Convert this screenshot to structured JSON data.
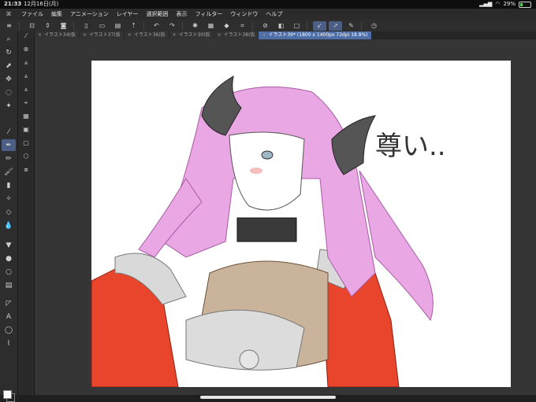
{
  "status": {
    "time": "21:33",
    "date": "12月16日(月)",
    "battery": "29%"
  },
  "menu": {
    "items": [
      "ファイル",
      "編集",
      "アニメーション",
      "レイヤー",
      "選択範囲",
      "表示",
      "フィルター",
      "ウィンドウ",
      "ヘルプ"
    ]
  },
  "tabs": [
    {
      "label": "イラスト34(仮"
    },
    {
      "label": "イラスト37(仮"
    },
    {
      "label": "イラスト36(仮"
    },
    {
      "label": "イラスト30(仮"
    },
    {
      "label": "イラスト38(仮"
    },
    {
      "label": "イラスト39* (1800 x 1400px 72dpi 18.8%)",
      "active": true
    }
  ],
  "canvas": {
    "handwriting": "尊い.."
  },
  "colors": {
    "accent": "#4a5e86",
    "active_tab": "#4e6ea8",
    "hair": "#e9a8e4",
    "outfit_red": "#e8452c",
    "fur": "#d9d9d9",
    "horns": "#555555"
  }
}
